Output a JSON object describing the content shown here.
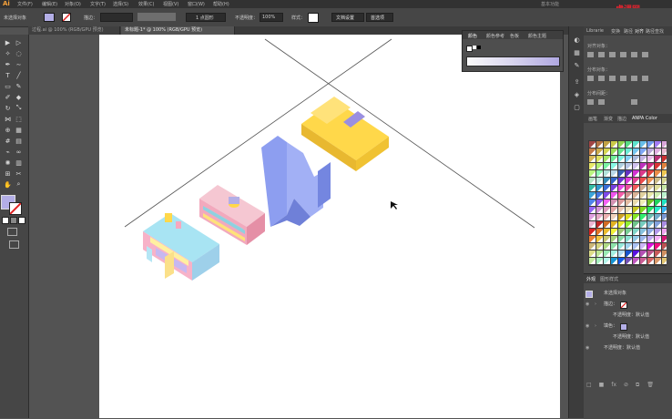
{
  "menubar": {
    "logo": "Ai",
    "items": [
      "文件(F)",
      "编辑(E)",
      "对象(O)",
      "文字(T)",
      "选择(S)",
      "效果(C)",
      "视图(V)",
      "窗口(W)",
      "帮助(H)"
    ],
    "right_text": "基本功能",
    "brand": "虎课网"
  },
  "control": {
    "selection_label": "未选择对象",
    "stroke_label": "描边：",
    "stroke_weight": "1 点圆形",
    "opacity_label": "不透明度：",
    "opacity_value": "100%",
    "style_label": "样式：",
    "doc_setup": "文档设置",
    "prefs": "首选项"
  },
  "tabs": [
    {
      "label": "过程.ai @ 100% (RGB/GPU 预览)",
      "active": false
    },
    {
      "label": "未标题-1* @ 100% (RGB/GPU 预览)",
      "active": true
    }
  ],
  "color_panel": {
    "tabs": [
      "颜色",
      "颜色参考",
      "色板",
      "颜色主题"
    ]
  },
  "right_panel": {
    "top_tabs": [
      "Librarie",
      "变换",
      "路径",
      "对齐",
      "路径查找"
    ],
    "align_objects": "对齐对象：",
    "distribute_objects": "分布对象：",
    "distribute_spacing": "分布间距：",
    "swatch_tabs": [
      "画笔",
      "渐变",
      "描边",
      "ANPA Color"
    ],
    "appearance_tabs": [
      "外观",
      "图形样式"
    ],
    "appearance_rows": [
      "未选择对象",
      "描边：",
      "不透明度：默认值",
      "填色：",
      "不透明度：默认值",
      "不透明度：默认值"
    ]
  },
  "colors": {
    "fill_swatch": "#b3aee6",
    "accent_blue": "#8d9ef0",
    "accent_yellow": "#ffd84a"
  },
  "icons": [
    "selection-tool",
    "direct-selection-tool",
    "magic-wand",
    "lasso",
    "pen",
    "type",
    "line",
    "rectangle",
    "paintbrush",
    "pencil",
    "eraser",
    "rotate",
    "scale",
    "width",
    "free-transform",
    "shape-builder",
    "perspective",
    "mesh",
    "gradient",
    "eyedropper",
    "blend",
    "symbol-sprayer",
    "column-graph",
    "artboard",
    "slice",
    "hand",
    "zoom"
  ]
}
